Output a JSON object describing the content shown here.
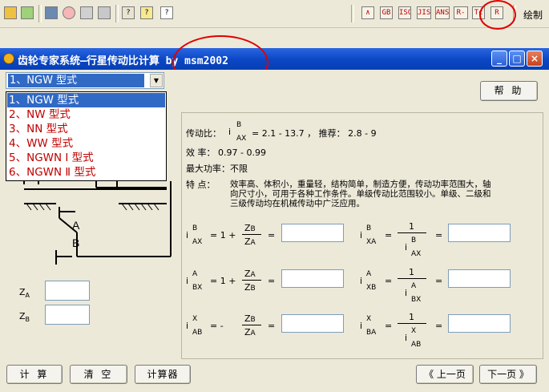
{
  "toolbar": {
    "right_icons": [
      "∧",
      "GB",
      "ISO",
      "JIS",
      "ANSI",
      "R-V",
      "Tc",
      "R"
    ],
    "draw_label": "绘制"
  },
  "window": {
    "title": "齿轮专家系统—行星传动比计算 by msm2002",
    "min": "_",
    "max": "□",
    "close": "×"
  },
  "combo": {
    "selected": "1、NGW 型式"
  },
  "dropdown": {
    "items": [
      "1、NGW 型式",
      "2、NW 型式",
      "3、NN 型式",
      "4、WW 型式",
      "5、NGWN Ⅰ 型式",
      "6、NGWN Ⅱ 型式"
    ]
  },
  "help_button": "帮 助",
  "info": {
    "ratio_label": "传动比：",
    "ratio_sym": "i",
    "ratio_sup": "B",
    "ratio_sub": "AX",
    "ratio_value": "= 2.1 - 13.7 ， 推荐： 2.8 - 9",
    "eff": "效  率： 0.97 - 0.99",
    "power": "最大功率：不限",
    "feature_label": "特  点：",
    "feature_lines": [
      "效率高、体积小，重量轻，结构简单，制造方便，传动功率范围大，轴",
      "向尺寸小，可用于各种工作条件。单级传动比范围较小。单级、二级和",
      "三级传动均在机械传动中广泛应用。"
    ]
  },
  "formulas": {
    "i": "i",
    "eq": "=",
    "one_plus": "= 1 +",
    "minus": "= -",
    "one": "1",
    "z": "Z",
    "f1": {
      "sup": "B",
      "sub": "AX",
      "num_sub": "B",
      "den_sub": "A"
    },
    "f2": {
      "sup": "A",
      "sub": "BX",
      "num_sub": "A",
      "den_sub": "B"
    },
    "f3": {
      "sup": "X",
      "sub": "AB",
      "num_sub": "B",
      "den_sub": "A"
    },
    "g1": {
      "sup": "B",
      "sub": "XA",
      "den_sup": "B",
      "den_sub": "AX"
    },
    "g2": {
      "sup": "A",
      "sub": "XB",
      "den_sup": "A",
      "den_sub": "BX"
    },
    "g3": {
      "sup": "X",
      "sub": "BA",
      "den_sup": "X",
      "den_sub": "AB"
    }
  },
  "diagram": {
    "label_a": "A",
    "label_b": "B"
  },
  "inputs": {
    "za_label": "Z",
    "za_sub": "A",
    "zb_label": "Z",
    "zb_sub": "B"
  },
  "buttons": {
    "calc": "计 算",
    "clear": "清 空",
    "calculator": "计算器",
    "prev": "《 上一页",
    "next": "下一页 》"
  }
}
